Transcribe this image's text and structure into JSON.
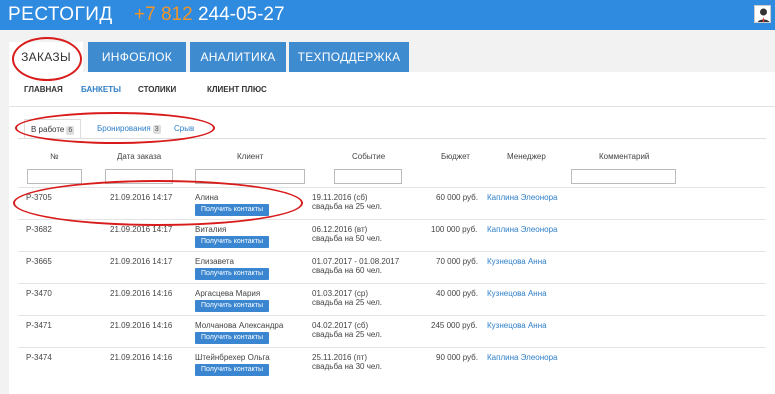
{
  "header": {
    "brand": "РЕСТОГИД",
    "phone_code": "+7 812",
    "phone_number": "244-05-27",
    "avatar_icon": "user-avatar-icon"
  },
  "main_tabs": [
    {
      "label": "ЗАКАЗЫ",
      "active": true
    },
    {
      "label": "ИНФОБЛОК",
      "active": false
    },
    {
      "label": "АНАЛИТИКА",
      "active": false
    },
    {
      "label": "ТЕХПОДДЕРЖКА",
      "active": false
    }
  ],
  "sub_nav": [
    {
      "label": "ГЛАВНАЯ",
      "active": false
    },
    {
      "label": "БАНКЕТЫ",
      "active": true
    },
    {
      "label": "СТОЛИКИ",
      "active": false
    },
    {
      "label": "КЛИЕНТ ПЛЮС",
      "active": false
    }
  ],
  "status_tabs": [
    {
      "label": "В работе",
      "count": "6",
      "active": true
    },
    {
      "label": "Бронирования",
      "count": "3",
      "active": false
    },
    {
      "label": "Срыв",
      "count": "",
      "active": false
    }
  ],
  "table": {
    "headers": [
      "№",
      "Дата заказа",
      "Клиент",
      "Событие",
      "Бюджет",
      "Менеджер",
      "Комментарий"
    ],
    "contact_button": "Получить контакты",
    "rows": [
      {
        "id": "P-3705",
        "date": "21.09.2016 14:17",
        "client": "Алина",
        "event_date": "19.11.2016 (сб)",
        "event_desc": "свадьба на 25 чел.",
        "budget": "60 000 руб.",
        "manager": "Каплина Элеонора"
      },
      {
        "id": "P-3682",
        "date": "21.09.2016 14:17",
        "client": "Виталия",
        "event_date": "06.12.2016 (вт)",
        "event_desc": "свадьба на 50 чел.",
        "budget": "100 000 руб.",
        "manager": "Каплина Элеонора"
      },
      {
        "id": "P-3665",
        "date": "21.09.2016 14:17",
        "client": "Елизавета",
        "event_date": "01.07.2017 - 01.08.2017",
        "event_desc": "свадьба на 60 чел.",
        "budget": "70 000 руб.",
        "manager": "Кузнецова Анна"
      },
      {
        "id": "P-3470",
        "date": "21.09.2016 14:16",
        "client": "Аргасцева Мария",
        "event_date": "01.03.2017 (ср)",
        "event_desc": "свадьба на 25 чел.",
        "budget": "40 000 руб.",
        "manager": "Кузнецова Анна"
      },
      {
        "id": "P-3471",
        "date": "21.09.2016 14:16",
        "client": "Молчанова Александра",
        "event_date": "04.02.2017 (сб)",
        "event_desc": "свадьба на 25 чел.",
        "budget": "245 000 руб.",
        "manager": "Кузнецова Анна"
      },
      {
        "id": "P-3474",
        "date": "21.09.2016 14:16",
        "client": "Штейнбрехер Ольга",
        "event_date": "25.11.2016 (пт)",
        "event_desc": "свадьба на 30 чел.",
        "budget": "90 000 руб.",
        "manager": "Каплина Элеонора"
      }
    ]
  },
  "colors": {
    "header_blue": "#2f8be0",
    "tab_blue": "#3f8bd0",
    "phone_orange": "#f0952a",
    "link_blue": "#2f7fc8",
    "annotation_red": "#d81b1b"
  }
}
